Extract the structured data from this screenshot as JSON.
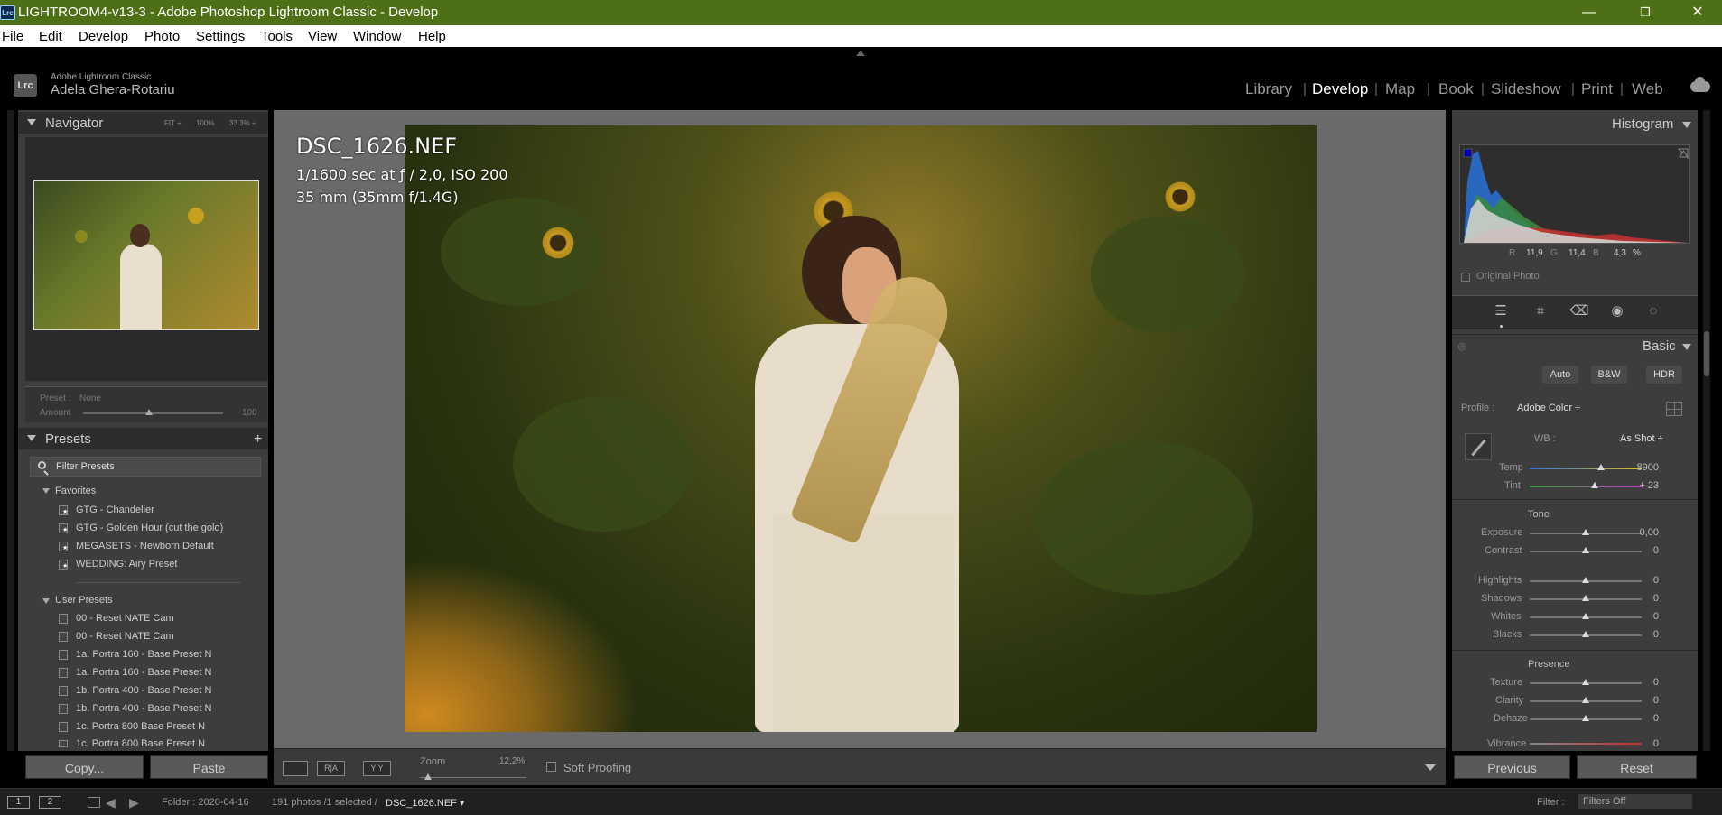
{
  "window": {
    "badge": "Lrc",
    "title": "LIGHTROOM4-v13-3 - Adobe Photoshop Lightroom Classic - Develop",
    "minimize": "—",
    "maximize": "❐",
    "close": "✕"
  },
  "menu": [
    "File",
    "Edit",
    "Develop",
    "Photo",
    "Settings",
    "Tools",
    "View",
    "Window",
    "Help"
  ],
  "identity": {
    "badge": "Lrc",
    "app": "Adobe Lightroom Classic",
    "user": "Adela Ghera-Rotariu"
  },
  "modules": [
    "Library",
    "Develop",
    "Map",
    "Book",
    "Slideshow",
    "Print",
    "Web"
  ],
  "active_module": "Develop",
  "navigator": {
    "title": "Navigator",
    "zoom_fit": "FIT ÷",
    "zoom_100": "100%",
    "zoom_33": "33.3% ÷",
    "preset_label": "Preset :",
    "preset_value": "None",
    "amount_label": "Amount",
    "amount_value": "100",
    "amount_fraction": 0.47
  },
  "presets": {
    "title": "Presets",
    "add": "+",
    "filter_placeholder": "Filter Presets",
    "favorites_label": "Favorites",
    "favorites": [
      "GTG - Chandelier",
      "GTG - Golden Hour  (cut the gold)",
      "MEGASETS - Newborn Default",
      "WEDDING: Airy Preset"
    ],
    "user_label": "User Presets",
    "user": [
      "00 - Reset NATE Cam",
      "00 - Reset NATE Cam",
      "1a. Portra 160 - Base Preset N",
      "1a. Portra 160 - Base Preset N",
      "1b. Portra 400 - Base Preset N",
      "1b. Portra 400 - Base Preset N",
      "1c. Portra 800 Base Preset N",
      "1c. Portra 800 Base Preset N"
    ]
  },
  "left_buttons": {
    "copy": "Copy...",
    "paste": "Paste"
  },
  "photo_info": {
    "filename": "DSC_1626.NEF",
    "exposure": "1/1600 sec at ƒ / 2,0, ISO 200",
    "lens": "35 mm (35mm f/1.4G)"
  },
  "toolbar": {
    "view_a": "R|A",
    "view_b": "Y|Y",
    "zoom_label": "Zoom",
    "zoom_value": "12,2%",
    "soft_proofing": "Soft Proofing"
  },
  "histogram": {
    "title": "Histogram",
    "r_label": "R",
    "r": "11,9",
    "g_label": "G",
    "g": "11,4",
    "b_label": "B",
    "b": "4,3",
    "pct": "%",
    "original_photo": "Original Photo"
  },
  "basic": {
    "title": "Basic",
    "auto": "Auto",
    "bw": "B&W",
    "hdr": "HDR",
    "profile_label": "Profile :",
    "profile_value": "Adobe Color ÷",
    "wb_label": "WB :",
    "wb_value": "As Shot ÷",
    "temp_label": "Temp",
    "temp": "8900",
    "tint_label": "Tint",
    "tint": "+ 23",
    "tone_label": "Tone",
    "presence_label": "Presence",
    "sliders": [
      {
        "label": "Exposure",
        "value": "0,00"
      },
      {
        "label": "Contrast",
        "value": "0"
      },
      {
        "label": "Highlights",
        "value": "0"
      },
      {
        "label": "Shadows",
        "value": "0"
      },
      {
        "label": "Whites",
        "value": "0"
      },
      {
        "label": "Blacks",
        "value": "0"
      },
      {
        "label": "Texture",
        "value": "0"
      },
      {
        "label": "Clarity",
        "value": "0"
      },
      {
        "label": "Dehaze",
        "value": "0"
      },
      {
        "label": "Vibrance",
        "value": "0"
      }
    ]
  },
  "right_buttons": {
    "previous": "Previous",
    "reset": "Reset"
  },
  "filmstrip": {
    "view1": "1",
    "view2": "2",
    "back": "◀",
    "forward": "▶",
    "folder": "Folder : 2020-04-16",
    "count": "191 photos /1 selected /",
    "file": "DSC_1626.NEF ▾",
    "filter_label": "Filter :",
    "filter_value": "Filters Off"
  },
  "colors": {
    "titlebar": "#4d6f15",
    "panel": "#3d3d3d",
    "background": "#6a6a6a"
  }
}
